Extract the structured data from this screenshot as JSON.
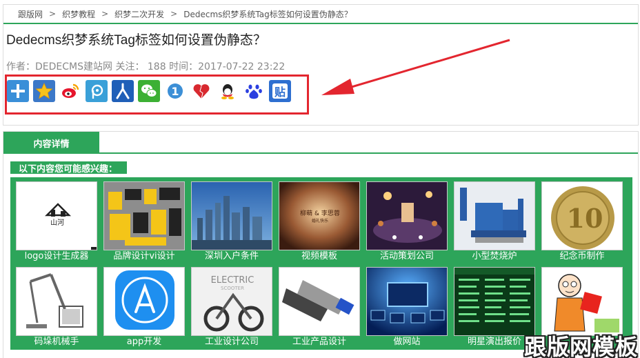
{
  "breadcrumb": [
    "跟版网",
    "织梦教程",
    "织梦二次开发",
    "Dedecms织梦系统Tag标签如何设置伪静态？"
  ],
  "breadcrumb_separator": ">",
  "article": {
    "title": "Dedecms织梦系统Tag标签如何设置伪静态？",
    "meta": "作者：DEDECMS建站网 关注： 188 时间：2017-07-22 23:22"
  },
  "share_buttons": [
    {
      "name": "share-more-icon",
      "color": "#3a8fd8",
      "glyph": "+"
    },
    {
      "name": "favorite-star-icon",
      "color": "#3b78c8",
      "glyph": "★"
    },
    {
      "name": "sina-weibo-icon",
      "color": "#e8473a",
      "glyph": "微"
    },
    {
      "name": "tencent-weibo-icon",
      "color": "#2e88c8",
      "glyph": "P"
    },
    {
      "name": "renren-icon",
      "color": "#1f5fb8",
      "glyph": "人"
    },
    {
      "name": "wechat-icon",
      "color": "#3cb034",
      "glyph": "微"
    },
    {
      "name": "yiyou-icon",
      "color": "#3c8fd6",
      "glyph": "1"
    },
    {
      "name": "heart-icon",
      "color": "#ffffff",
      "glyph": "♥"
    },
    {
      "name": "qq-icon",
      "color": "#ffffff",
      "glyph": "Q"
    },
    {
      "name": "baidu-icon",
      "color": "#ffffff",
      "glyph": "百"
    },
    {
      "name": "tieba-icon",
      "color": "#2e6fd0",
      "glyph": "贴"
    }
  ],
  "tab_label": "内容详情",
  "interest_label": "以下内容您可能感兴趣：",
  "tiles": [
    {
      "caption": "logo设计生成器",
      "bg": "#ffffff"
    },
    {
      "caption": "品牌设计vi设计",
      "bg": "#8a8a8a"
    },
    {
      "caption": "深圳入户条件",
      "bg": "#3a73b8"
    },
    {
      "caption": "视频模板",
      "bg": "#7a4a2c"
    },
    {
      "caption": "活动策划公司",
      "bg": "#3a2a4a"
    },
    {
      "caption": "小型焚烧炉",
      "bg": "#e9edf2"
    },
    {
      "caption": "纪念币制作",
      "bg": "#ffffff"
    },
    {
      "caption": "码垛机械手",
      "bg": "#ffffff"
    },
    {
      "caption": "app开发",
      "bg": "#ffffff"
    },
    {
      "caption": "工业设计公司",
      "bg": "#f1f1f1"
    },
    {
      "caption": "工业产品设计",
      "bg": "#ffffff"
    },
    {
      "caption": "做网站",
      "bg": "#062a6e"
    },
    {
      "caption": "明星演出报价",
      "bg": "#0a3a18"
    },
    {
      "caption": "",
      "bg": "#ffffff"
    }
  ],
  "watermark": "跟版网模板",
  "colors": {
    "accent": "#2da55a",
    "highlight": "#e3262f"
  }
}
